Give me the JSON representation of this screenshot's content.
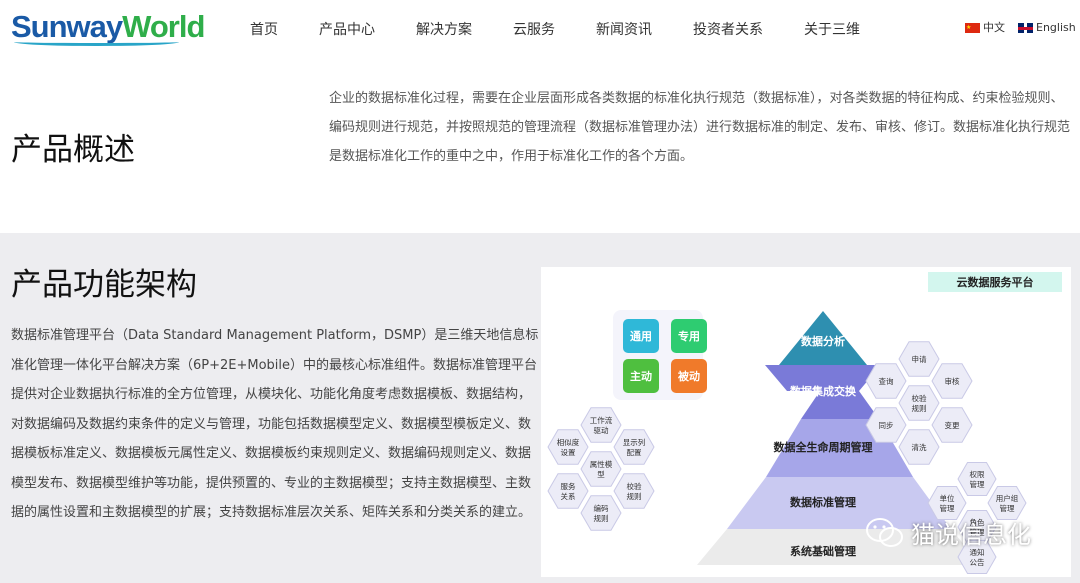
{
  "header": {
    "logo_part1": "Sunway",
    "logo_part2": "World",
    "nav": [
      "首页",
      "产品中心",
      "解决方案",
      "云服务",
      "新闻资讯",
      "投资者关系",
      "关于三维"
    ],
    "lang_cn": "中文",
    "lang_en": "English"
  },
  "overview": {
    "title": "产品概述",
    "text": "企业的数据标准化过程，需要在企业层面形成各类数据的标准化执行规范（数据标准），对各类数据的特征构成、约束检验规则、编码规则进行规范，并按照规范的管理流程（数据标准管理办法）进行数据标准的制定、发布、审核、修订。数据标准化执行规范是数据标准化工作的重中之中，作用于标准化工作的各个方面。"
  },
  "architecture": {
    "title": "产品功能架构",
    "text": "数据标准管理平台（Data Standard Management Platform，DSMP）是三维天地信息标准化管理一体化平台解决方案（6P+2E+Mobile）中的最核心标准组件。数据标准管理平台提供对企业数据执行标准的全方位管理，从模块化、功能化角度考虑数据模板、数据结构，对数据编码及数据约束条件的定义与管理，功能包括数据模型定义、数据模型模板定义、数据模板标准定义、数据模板元属性定义、数据模板约束规则定义、数据编码规则定义、数据模型发布、数据模型维护等功能，提供预置的、专业的主数据模型；支持主数据模型、主数据的属性设置和主数据模型的扩展；支持数据标准层次关系、矩阵关系和分类关系的建立。"
  },
  "diagram": {
    "platform_label": "云数据服务平台",
    "layers": [
      "数据分析",
      "数据集成交换",
      "数据全生命周期管理",
      "数据标准管理",
      "系统基础管理"
    ],
    "quad": [
      "通用",
      "专用",
      "主动",
      "被动"
    ],
    "quad_colors": [
      "#2fb8d8",
      "#2ecc71",
      "#4fbf3f",
      "#f07a2a"
    ],
    "left_hexes": [
      [
        "工作流",
        "驱动"
      ],
      [
        "相似度",
        "设置"
      ],
      [
        "显示列",
        "配置"
      ],
      [
        "属性模",
        "型"
      ],
      [
        "服务",
        "关系"
      ],
      [
        "校验",
        "规则"
      ],
      [
        "编码",
        "规则"
      ]
    ],
    "right_hexes": [
      [
        "申请"
      ],
      [
        "查询"
      ],
      [
        "审核"
      ],
      [
        "校验",
        "规则"
      ],
      [
        "同步"
      ],
      [
        "变更"
      ],
      [
        "清洗"
      ]
    ],
    "bottom_hexes": [
      [
        "权限",
        "管理"
      ],
      [
        "单位",
        "管理"
      ],
      [
        "用户组",
        "管理"
      ],
      [
        "角色",
        "管理"
      ],
      [
        "通知",
        "公告"
      ]
    ]
  },
  "watermark": "猫说信息化"
}
